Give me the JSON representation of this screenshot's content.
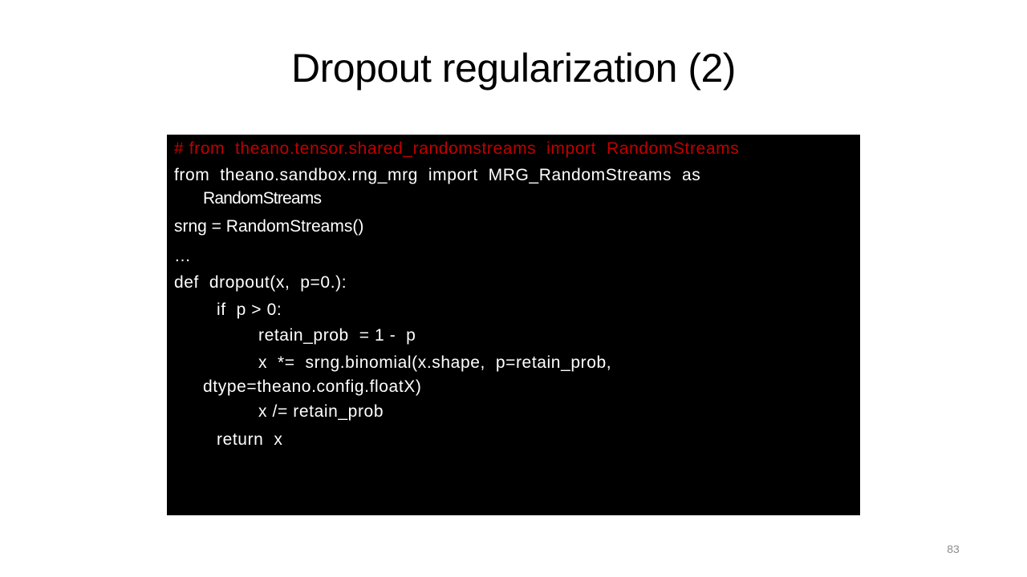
{
  "slide": {
    "title": "Dropout regularization (2)",
    "page_number": "83"
  },
  "code": {
    "background_color": "#000000",
    "comment_color": "#c00000",
    "lines": [
      "# from  theano.tensor.shared_randomstreams  import  RandomStreams",
      "from  theano.sandbox.rng_mrg  import  MRG_RandomStreams  as",
      "RandomStreams",
      "srng = RandomStreams()",
      "…",
      "def  dropout(x,  p=0.):",
      "if  p > 0:",
      "retain_prob  = 1 -  p",
      "x  *=  srng.binomial(x.shape,  p=retain_prob,",
      "dtype=theano.config.floatX)",
      "x /= retain_prob",
      "return  x"
    ]
  }
}
